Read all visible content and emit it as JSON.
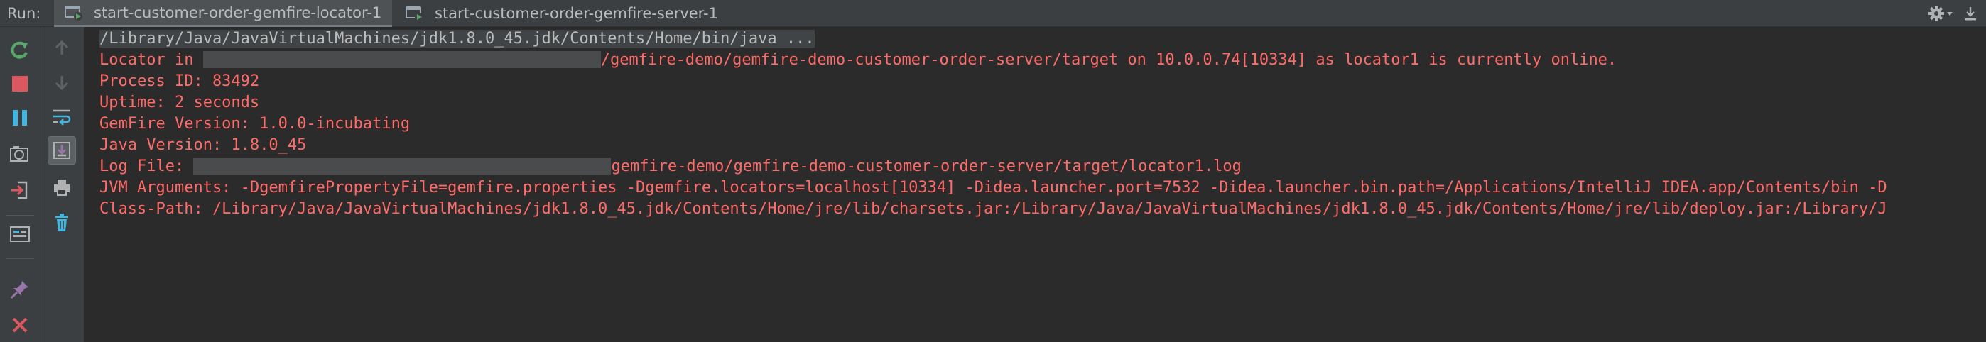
{
  "run": {
    "label": "Run:",
    "tabs": [
      {
        "label": "start-customer-order-gemfire-locator-1",
        "active": true
      },
      {
        "label": "start-customer-order-gemfire-server-1",
        "active": false
      }
    ],
    "settings_icon": "gear-icon",
    "hide_icon": "minimize-icon"
  },
  "toolbar": {
    "left": [
      "rerun-icon",
      "stop-icon",
      "pause-icon",
      "dump-threads-icon",
      "exit-icon",
      "layout-icon",
      "pin-icon",
      "close-icon"
    ],
    "right": [
      "up-arrow-icon",
      "down-arrow-icon",
      "soft-wrap-icon",
      "scroll-to-end-icon",
      "print-icon",
      "clear-all-icon"
    ]
  },
  "console": {
    "command": "/Library/Java/JavaVirtualMachines/jdk1.8.0_45.jdk/Contents/Home/bin/java ...",
    "locator_prefix": "Locator in ",
    "locator_suffix": "/gemfire-demo/gemfire-demo-customer-order-server/target on 10.0.0.74[10334] as locator1 is currently online.",
    "process_id": "Process ID: 83492",
    "uptime": "Uptime: 2 seconds",
    "gemfire_version": "GemFire Version: 1.0.0-incubating",
    "java_version": "Java Version: 1.8.0_45",
    "log_prefix": "Log File: ",
    "log_suffix": "gemfire-demo/gemfire-demo-customer-order-server/target/locator1.log",
    "jvm_args": "JVM Arguments: -DgemfirePropertyFile=gemfire.properties -Dgemfire.locators=localhost[10334] -Didea.launcher.port=7532 -Didea.launcher.bin.path=/Applications/IntelliJ IDEA.app/Contents/bin -D",
    "class_path": "Class-Path: /Library/Java/JavaVirtualMachines/jdk1.8.0_45.jdk/Contents/Home/jre/lib/charsets.jar:/Library/Java/JavaVirtualMachines/jdk1.8.0_45.jdk/Contents/Home/jre/lib/deploy.jar:/Library/J"
  },
  "colors": {
    "console_bg": "#2b2b2b",
    "output_red": "#ff6b68",
    "command_gray": "#bbbbbb",
    "toolbar_bg": "#3c3f41"
  }
}
